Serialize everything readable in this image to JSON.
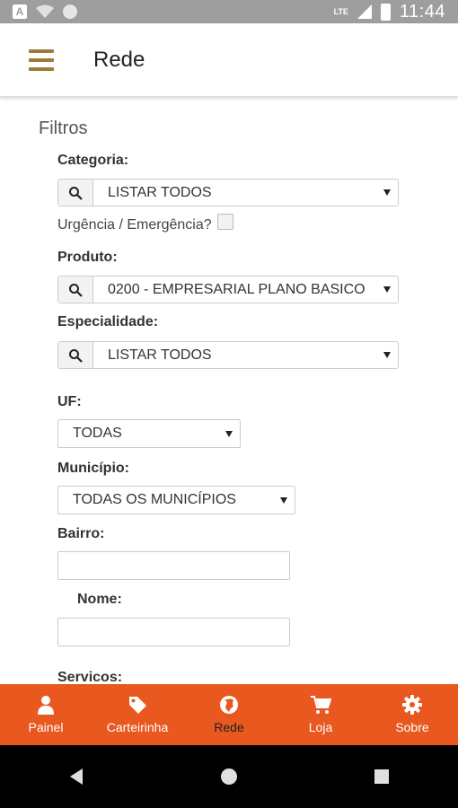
{
  "status_bar": {
    "time": "11:44",
    "network": "LTE"
  },
  "app_bar": {
    "title": "Rede"
  },
  "filters": {
    "heading": "Filtros",
    "categoria": {
      "label": "Categoria:",
      "value": "LISTAR TODOS"
    },
    "urgencia": {
      "label": "Urgência / Emergência?",
      "checked": false
    },
    "produto": {
      "label": "Produto:",
      "value": "0200 - EMPRESARIAL PLANO BASICO"
    },
    "especialidade": {
      "label": "Especialidade:",
      "value": "LISTAR TODOS"
    },
    "uf": {
      "label": "UF:",
      "value": "TODAS"
    },
    "municipio": {
      "label": "Município:",
      "value": "TODAS OS MUNICÍPIOS"
    },
    "bairro": {
      "label": "Bairro:",
      "value": ""
    },
    "nome": {
      "label": "Nome:",
      "value": ""
    },
    "servicos": {
      "label": "Servicos:"
    }
  },
  "bottom_nav": {
    "items": [
      {
        "label": "Painel",
        "icon": "user-icon",
        "active": false
      },
      {
        "label": "Carteirinha",
        "icon": "tag-icon",
        "active": false
      },
      {
        "label": "Rede",
        "icon": "globe-icon",
        "active": true
      },
      {
        "label": "Loja",
        "icon": "cart-icon",
        "active": false
      },
      {
        "label": "Sobre",
        "icon": "gear-icon",
        "active": false
      }
    ]
  },
  "colors": {
    "nav_bg": "#e8581f",
    "menu_icon": "#9b7d3a",
    "status_bar": "#9e9e9e"
  }
}
